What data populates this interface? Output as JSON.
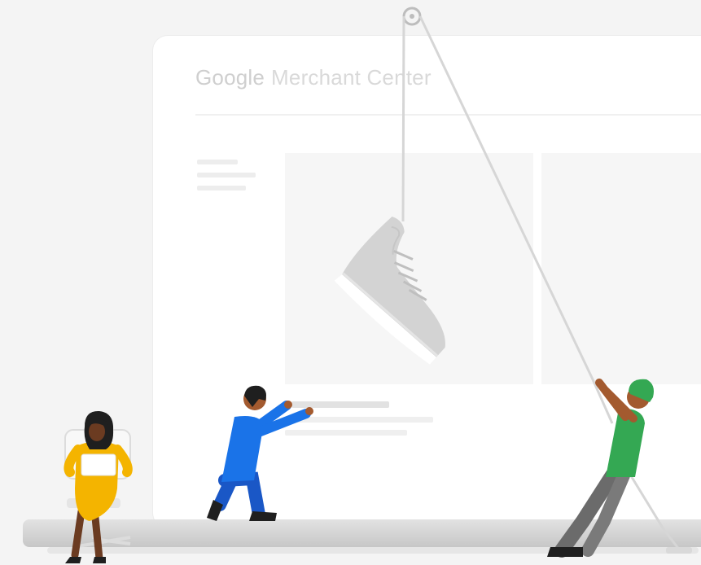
{
  "brand": {
    "logo_word": "Google",
    "product_name": "Merchant Center"
  },
  "scene": {
    "hanging_item": "sneaker",
    "rope": "pulley-rope",
    "people": [
      "person-with-laptop-on-chair",
      "person-kneeling-pulling-bar",
      "person-pulling-rope"
    ]
  },
  "colors": {
    "background": "#f4f4f4",
    "screen": "#ffffff",
    "laptop_base": "#cfcfcf",
    "sneaker": "#d3d3d3",
    "yellow_shirt": "#f4b400",
    "blue_outfit": "#1a73e8",
    "green_shirt": "#34a853",
    "skin_dark": "#6b3b21",
    "skin_medium": "#a35a2f",
    "hair_dark": "#1f1f1f"
  }
}
